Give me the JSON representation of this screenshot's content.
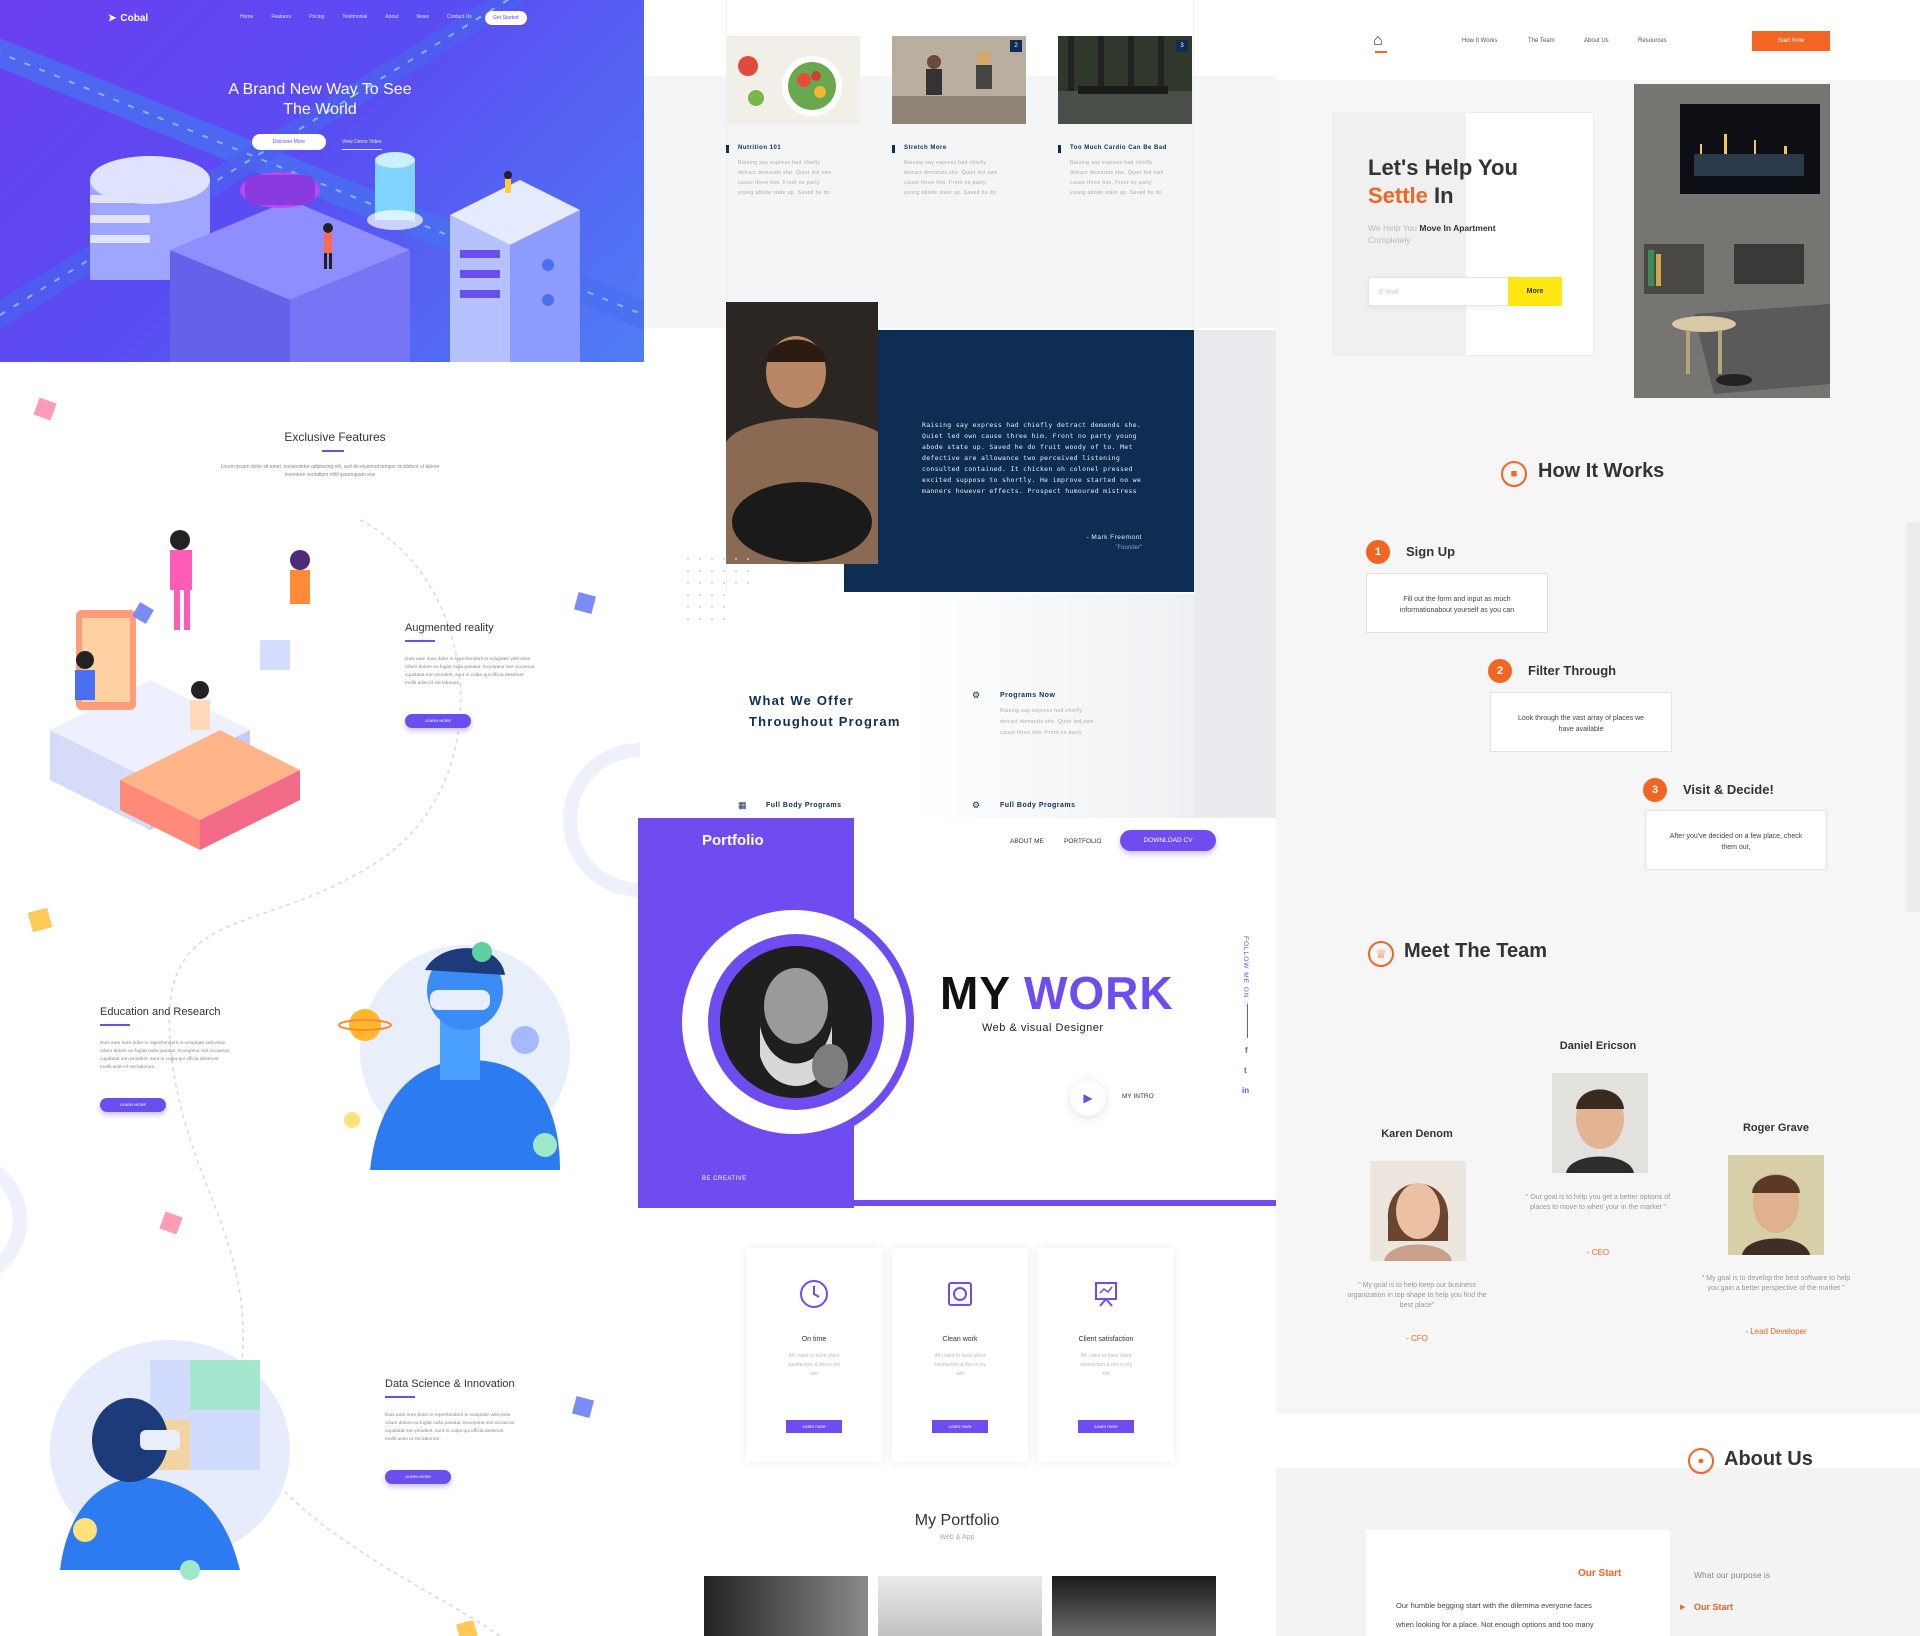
{
  "cobal": {
    "logo": "Cobal",
    "nav": [
      "Home",
      "Features",
      "Pricing",
      "Testimonial",
      "About",
      "News",
      "Contact Us"
    ],
    "cta": "Get Started",
    "hero_title_line1": "A Brand New Way To See",
    "hero_title_line2": "The World",
    "discover_button": "Discover More",
    "demo_link": "View Demo Video",
    "features_title": "Exclusive Features",
    "features_text_1": "Lorem ipsum dolor sit amet, consectetur adipiscing elit, sed do eiusmod tempor incididunt ut labore",
    "features_text_2": "inventore veritatipm nihil ipsumquam eos",
    "body_line_1": "Duis aute irure dolor in reprehenderit in voluptate velit esse",
    "body_line_2": "cillum dolore eu fugiat nulla pariatur. Excepteur sint occaecat",
    "body_line_3": "cupidatat non proident, sunt in culpa qui officia deserunt",
    "body_line_4": "mollit anim id est laborum.",
    "learn_more": "LEARN MORE",
    "features": [
      {
        "title": "Augmented reality"
      },
      {
        "title": "Education and Research"
      },
      {
        "title": "Data Science & Innovation"
      }
    ]
  },
  "fitness": {
    "cards": [
      {
        "number": "",
        "title": "Nutrition 101"
      },
      {
        "number": "2",
        "title": "Stretch More"
      },
      {
        "number": "3",
        "title": "Too Much Cardio Can Be Bad"
      }
    ],
    "card_text_1": "Raising say express had chiefly",
    "card_text_2": "detract demands she. Quiet led own",
    "card_text_3": "cause three him. Front no party",
    "card_text_4": "young abode state up. Saved he do",
    "quote_lines": [
      "Raising say express had chiefly detract demands she.",
      "Quiet led own cause three him. Front no party young",
      "abode state up. Saved he do fruit woody of to. Met",
      "defective are allowance two perceived listening",
      "consulted contained. It chicken oh colonel pressed",
      "excited suppose to shortly. He improve started no we",
      "manners however effects. Prospect humoured mistress"
    ],
    "quote_author": "- Mark Freemont",
    "quote_role": "\"Founder\"",
    "offer_line1": "What We Offer",
    "offer_line2": "Throughout Program",
    "programs_now": "Programs Now",
    "programs_text_1": "Raising say express had chiefly",
    "programs_text_2": "detract demands she. Quiet led own",
    "programs_text_3": "cause three him. Front no party",
    "full_body_1": "Full Body Programs",
    "full_body_2": "Full Body Programs"
  },
  "portfolio": {
    "logo": "Portfolio",
    "nav_about": "ABOUT ME",
    "nav_portfolio": "PORTFOLIO",
    "download_cv": "DOWNLOAD CV",
    "headline_my": "MY",
    "headline_work": "WORK",
    "subtitle": "Web & visual Designer",
    "intro": "MY INTRO",
    "follow": "FOLLOW ME ON :",
    "be_creative": "BE CREATIVE",
    "social": [
      "f",
      "t",
      "in"
    ],
    "services": [
      {
        "title": "On time",
        "icon": "clock-icon"
      },
      {
        "title": "Clean work",
        "icon": "frame-icon"
      },
      {
        "title": "Client satisfaction",
        "icon": "easel-icon"
      }
    ],
    "svc_text_1": "All i want to have client",
    "svc_text_2": "satisfaction & this is my",
    "svc_text_3": "aim",
    "svc_btn": "Learn more",
    "my_portfolio": "My Portfolio",
    "web_app": "Web & App",
    "accent": "#6e4cf0"
  },
  "apartment": {
    "nav": [
      "How It Works",
      "The Team",
      "About Us",
      "Resources"
    ],
    "start_now": "Start Now",
    "hero_title_1": "Let's Help You",
    "hero_title_2a": "Settle",
    "hero_title_2b": "In",
    "hero_sub_a": "We Help You",
    "hero_sub_b": "Move In Apartment",
    "hero_sub_c": "Completely",
    "email_placeholder": "E-Mail",
    "more_button": "More",
    "how_title": "How It Works",
    "steps": [
      {
        "num": "1",
        "title": "Sign Up",
        "text": "Fill out the form and input as much informationabout yourself as you can"
      },
      {
        "num": "2",
        "title": "Filter Through",
        "text": "Look through the vast array of places we have available"
      },
      {
        "num": "3",
        "title": "Visit & Decide!",
        "text": "After you've decided on a few place, check them out,"
      }
    ],
    "team_title": "Meet The Team",
    "team": [
      {
        "name": "Karen Denom",
        "quote": "\" My goal is to help keep our business organization in top shape to help you find the best place\"",
        "role": "- CFO"
      },
      {
        "name": "Daniel Ericson",
        "quote": "\" Our goal is to help you get a better options of places to move to when your in the market \"",
        "role": "- CEO"
      },
      {
        "name": "Roger Grave",
        "quote": "\" My goal is to develop the best software to help you gain a better perspective of the market \"",
        "role": "- Lead Developer"
      }
    ],
    "about_title": "About Us",
    "our_start": "Our Start",
    "about_text_1": "Our humble begging start with the dilemma everyone faces",
    "about_text_2": "when looking for a place. Not enough options and too many",
    "purpose": "What our purpose is",
    "purpose_item": "Our Start",
    "accent": "#f26522"
  }
}
